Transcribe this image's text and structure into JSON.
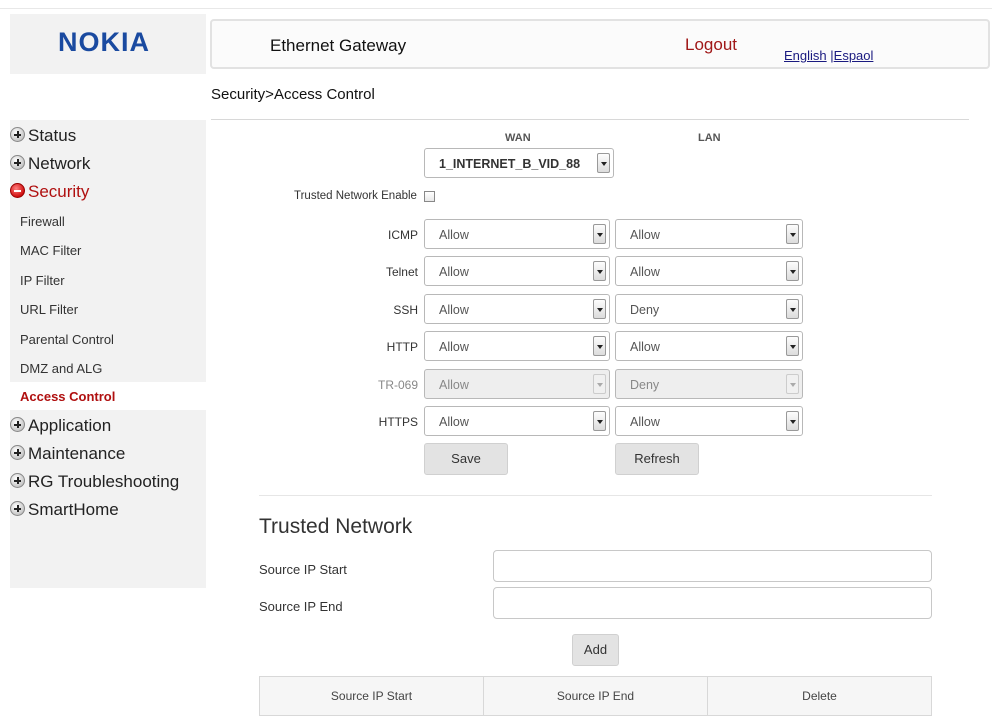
{
  "logo": {
    "text": "NOKIA"
  },
  "header": {
    "title": "Ethernet Gateway",
    "logout_label": "Logout",
    "lang_english": "English",
    "lang_sep": "|",
    "lang_espanol": "Espaol"
  },
  "breadcrumb": "Security>Access Control",
  "sidebar": {
    "items": [
      {
        "label": "Status",
        "state": "collapsed"
      },
      {
        "label": "Network",
        "state": "collapsed"
      },
      {
        "label": "Security",
        "state": "expanded"
      },
      {
        "label": "Application",
        "state": "collapsed"
      },
      {
        "label": "Maintenance",
        "state": "collapsed"
      },
      {
        "label": "RG Troubleshooting",
        "state": "collapsed"
      },
      {
        "label": "SmartHome",
        "state": "collapsed"
      }
    ],
    "security_sub": [
      "Firewall",
      "MAC Filter",
      "IP Filter",
      "URL Filter",
      "Parental Control",
      "DMZ and ALG",
      "Access Control"
    ],
    "active_sub": "Access Control"
  },
  "access_control": {
    "wan_header": "WAN",
    "lan_header": "LAN",
    "wan_interface": "1_INTERNET_B_VID_88",
    "trusted_network_enable_label": "Trusted Network Enable",
    "trusted_network_enable_checked": false,
    "rows": [
      {
        "label": "ICMP",
        "wan": "Allow",
        "lan": "Allow",
        "disabled": false
      },
      {
        "label": "Telnet",
        "wan": "Allow",
        "lan": "Allow",
        "disabled": false
      },
      {
        "label": "SSH",
        "wan": "Allow",
        "lan": "Deny",
        "disabled": false
      },
      {
        "label": "HTTP",
        "wan": "Allow",
        "lan": "Allow",
        "disabled": false
      },
      {
        "label": "TR-069",
        "wan": "Allow",
        "lan": "Deny",
        "disabled": true
      },
      {
        "label": "HTTPS",
        "wan": "Allow",
        "lan": "Allow",
        "disabled": false
      }
    ],
    "save_label": "Save",
    "refresh_label": "Refresh"
  },
  "trusted_network": {
    "title": "Trusted Network",
    "source_ip_start_label": "Source IP Start",
    "source_ip_end_label": "Source IP End",
    "source_ip_start_value": "",
    "source_ip_end_value": "",
    "add_label": "Add",
    "table_headers": [
      "Source IP Start",
      "Source IP End",
      "Delete"
    ]
  },
  "colors": {
    "brand": "#1a4aa0",
    "accent_red": "#b01010",
    "sidebar_bg": "#f2f2f2"
  }
}
